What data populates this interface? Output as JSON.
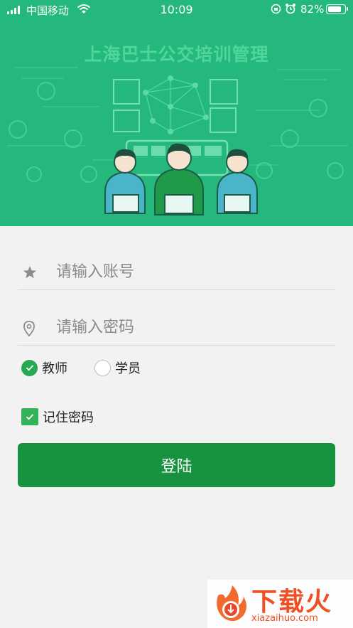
{
  "status_bar": {
    "carrier": "中国移动",
    "time": "10:09",
    "battery_percent": "82%",
    "battery_level": 0.82
  },
  "header": {
    "title": "上海巴士公交培训管理"
  },
  "form": {
    "account": {
      "placeholder": "请输入账号",
      "value": "",
      "icon": "star-icon"
    },
    "password": {
      "placeholder": "请输入密码",
      "value": "",
      "icon": "location-pin-icon"
    },
    "roles": [
      {
        "label": "教师",
        "selected": true
      },
      {
        "label": "学员",
        "selected": false
      }
    ],
    "remember": {
      "label": "记住密码",
      "checked": true
    },
    "login_label": "登陆"
  },
  "watermark": {
    "text": "下载火",
    "domain": "xiazaihuo.com"
  },
  "colors": {
    "header_bg": "#24b87c",
    "accent_green": "#27a94f",
    "button_green": "#17923f"
  }
}
